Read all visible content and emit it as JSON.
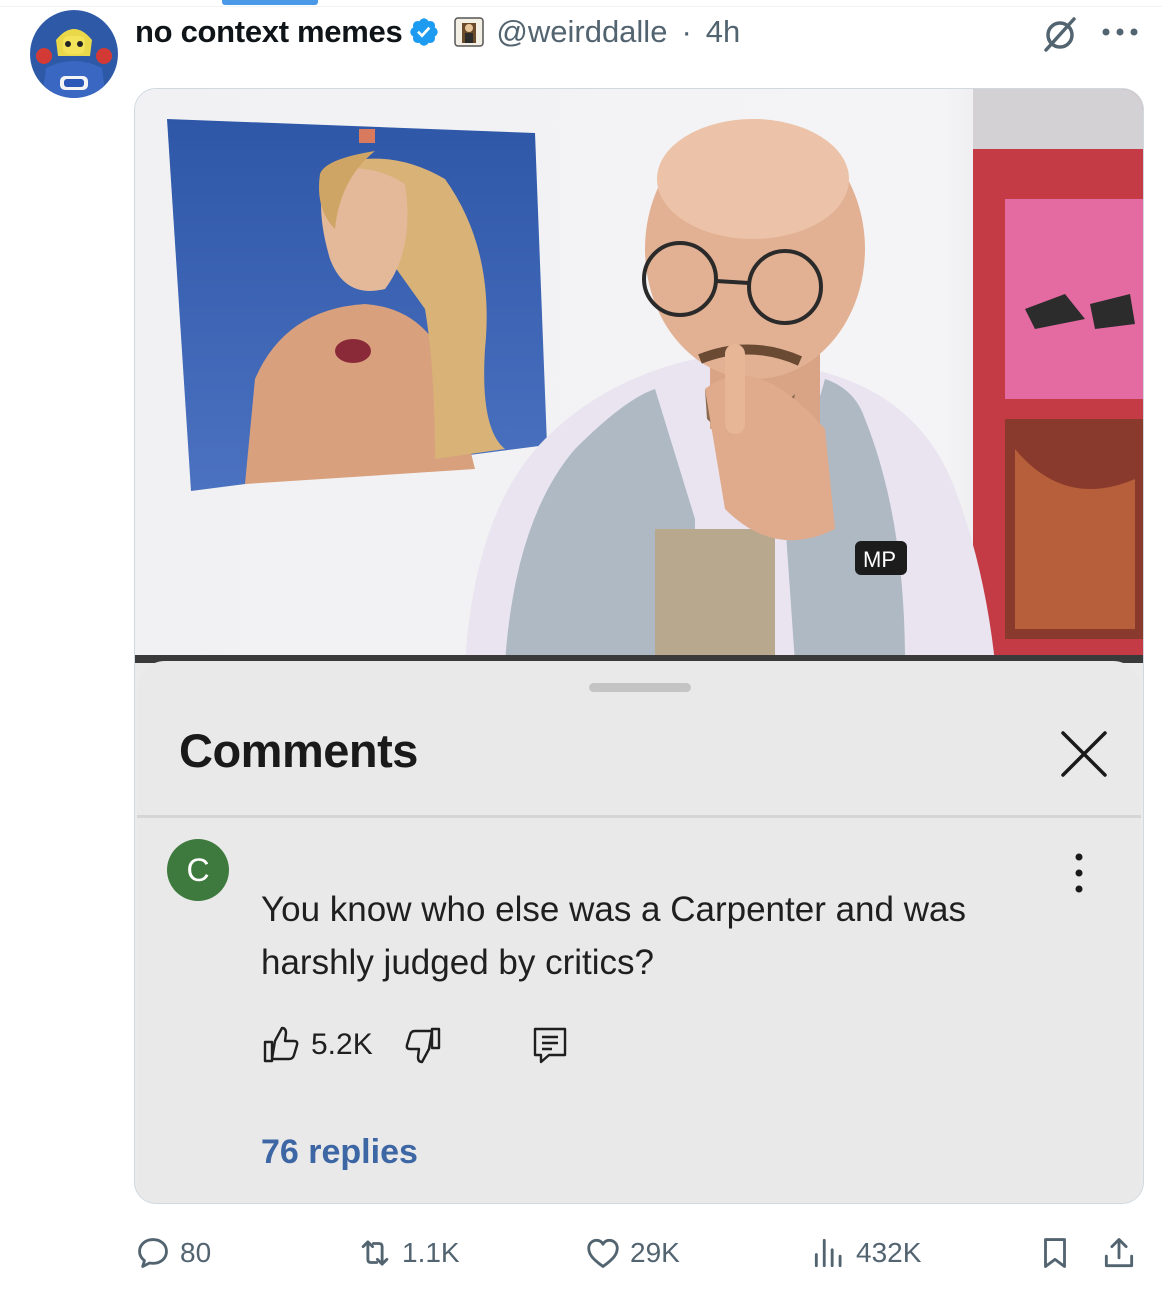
{
  "post": {
    "author_name": "no context memes",
    "handle": "@weirddalle",
    "separator": "·",
    "time": "4h"
  },
  "media": {
    "comments_panel": {
      "title": "Comments",
      "comment": {
        "avatar_letter": "C",
        "text": "You know who else was a Carpenter and was harshly judged by critics?",
        "likes": "5.2K",
        "replies_label": "76 replies"
      }
    }
  },
  "stats": {
    "replies": "80",
    "reposts": "1.1K",
    "likes": "29K",
    "views": "432K"
  },
  "icons": [
    "verified-badge-icon",
    "grok-icon",
    "more-icon",
    "close-icon",
    "thumbs-up-icon",
    "thumbs-down-icon",
    "reply-comment-icon",
    "kebab-menu-icon",
    "reply-icon",
    "repost-icon",
    "like-icon",
    "views-icon",
    "bookmark-icon",
    "share-icon"
  ],
  "colors": {
    "verified": "#1d9bf0",
    "replies_link": "#3d66a4",
    "muted_text": "#536471",
    "comment_avatar": "#3e7a3d"
  }
}
